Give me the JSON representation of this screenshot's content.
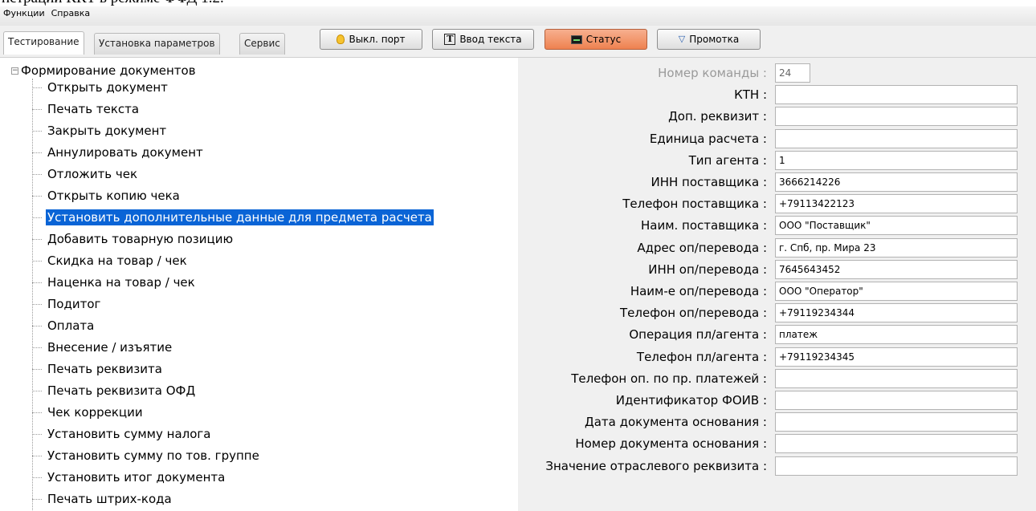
{
  "doc_strip": "нстрации ККТ в режиме ФФД 1.2.",
  "menu": [
    "Функции",
    "Справка"
  ],
  "tabs": [
    {
      "label": "Тестирование",
      "active": true
    },
    {
      "label": "Установка параметров",
      "active": false
    },
    {
      "label": "Сервис",
      "active": false
    }
  ],
  "toolbar": {
    "port_label": "Выкл. порт",
    "text_label": "Ввод текста",
    "status_label": "Статус",
    "feed_label": "Промотка",
    "status_color": "#ee8150"
  },
  "tree": {
    "root": "Формирование документов",
    "items": [
      "Открыть документ",
      "Печать текста",
      "Закрыть документ",
      "Аннулировать документ",
      "Отложить чек",
      "Открыть копию чека",
      "Установить дополнительные данные для предмета расчета",
      "Добавить товарную позицию",
      "Скидка на товар / чек",
      "Наценка на товар / чек",
      "Подитог",
      "Оплата",
      "Внесение / изъятие",
      "Печать реквизита",
      "Печать реквизита ОФД",
      "Чек коррекции",
      "Установить сумму налога",
      "Установить сумму по тов. группе",
      "Установить итог документа",
      "Печать штрих-кода"
    ],
    "selected_index": 6,
    "selection_color": "#0a64d6"
  },
  "form": {
    "fields": [
      {
        "label": "Номер команды :",
        "value": "24"
      },
      {
        "label": "КТН :",
        "value": ""
      },
      {
        "label": "Доп. реквизит :",
        "value": ""
      },
      {
        "label": "Единица расчета :",
        "value": ""
      },
      {
        "label": "Тип агента :",
        "value": "1"
      },
      {
        "label": "ИНН поставщика :",
        "value": "3666214226"
      },
      {
        "label": "Телефон поставщика :",
        "value": "+79113422123"
      },
      {
        "label": "Наим. поставщика :",
        "value": "ООО \"Поставщик\""
      },
      {
        "label": "Адрес оп/перевода :",
        "value": "г. Спб, пр. Мира 23"
      },
      {
        "label": "ИНН оп/перевода :",
        "value": "7645643452"
      },
      {
        "label": "Наим-е оп/перевода :",
        "value": "ООО \"Оператор\""
      },
      {
        "label": "Телефон оп/перевода :",
        "value": "+79119234344"
      },
      {
        "label": "Операция пл/агента :",
        "value": "платеж"
      },
      {
        "label": "Телефон пл/агента :",
        "value": "+79119234345"
      },
      {
        "label": "Телефон оп. по пр. платежей :",
        "value": ""
      },
      {
        "label": "Идентификатор ФОИВ :",
        "value": ""
      },
      {
        "label": "Дата документа основания :",
        "value": ""
      },
      {
        "label": "Номер документа основания :",
        "value": ""
      },
      {
        "label": "Значение отраслевого реквизита :",
        "value": ""
      }
    ]
  }
}
